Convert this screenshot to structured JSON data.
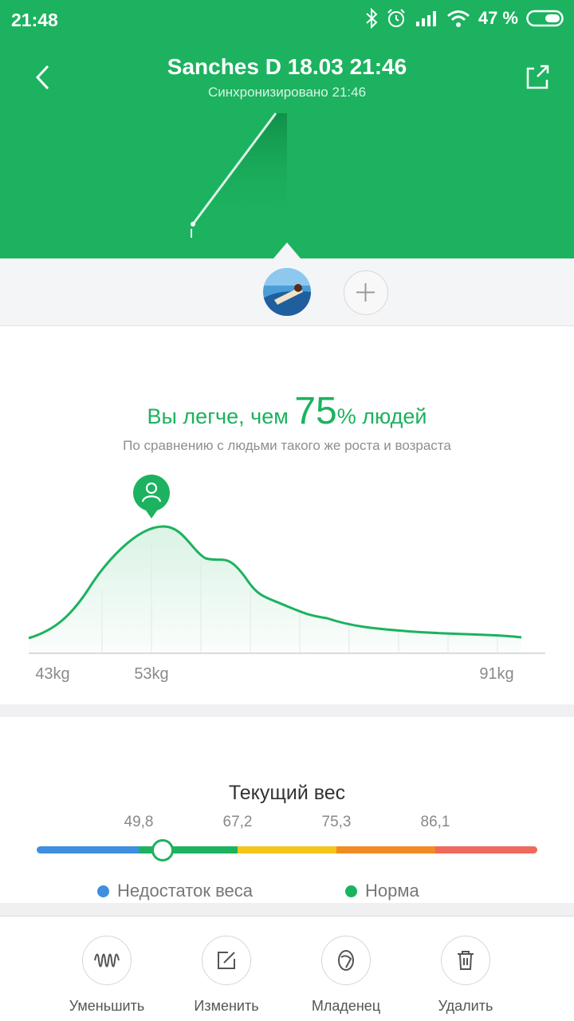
{
  "status_bar": {
    "time": "21:48",
    "battery_percent": "47 %",
    "icons": [
      "bluetooth-icon",
      "alarm-icon",
      "signal-icon",
      "wifi-icon",
      "battery-icon"
    ]
  },
  "header": {
    "title": "Sanches D 18.03 21:46",
    "subtitle": "Синхронизировано 21:46"
  },
  "comparison": {
    "prefix": "Вы легче, чем",
    "percent": "75",
    "suffix": "% людей",
    "subtitle": "По сравнению с людьми такого же роста и возраста"
  },
  "distribution": {
    "x_labels": [
      "43kg",
      "53kg",
      "91kg"
    ]
  },
  "current_weight": {
    "title": "Текущий вес",
    "thresholds": [
      "49,8",
      "67,2",
      "75,3",
      "86,1"
    ],
    "legend": [
      {
        "label": "Недостаток веса",
        "color": "#3f8ee0"
      },
      {
        "label": "Норма",
        "color": "#1cb25f"
      }
    ]
  },
  "actions": [
    {
      "label": "Уменьшить",
      "icon": "waveform-icon"
    },
    {
      "label": "Изменить",
      "icon": "edit-icon"
    },
    {
      "label": "Младенец",
      "icon": "baby-icon"
    },
    {
      "label": "Удалить",
      "icon": "trash-icon"
    }
  ],
  "colors": {
    "accent": "#1cb25f",
    "underweight": "#3f8ee0",
    "normal": "#1cb25f",
    "overweight": "#f5c518",
    "obese": "#f18b22",
    "severe": "#f0695a"
  }
}
